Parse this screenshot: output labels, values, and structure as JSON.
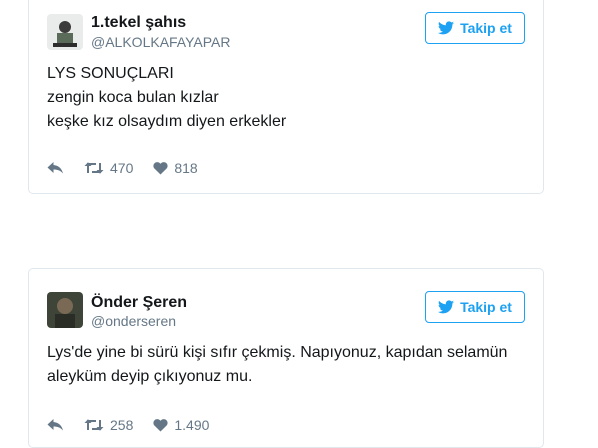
{
  "tweets": [
    {
      "name": "1.tekel şahıs",
      "handle": "@ALKOLKAFAYAPAR",
      "follow_label": "Takip et",
      "text_lines": [
        "LYS SONUÇLARI",
        "zengin koca bulan kızlar",
        "keşke kız olsaydım diyen erkekler"
      ],
      "retweets": "470",
      "likes": "818"
    },
    {
      "name": "Önder Şeren",
      "handle": "@onderseren",
      "follow_label": "Takip et",
      "text_lines": [
        "Lys'de yine bi sürü kişi sıfır çekmiş. Napıyonuz, kapıdan selamün",
        "aleyküm deyip çıkıyonuz mu."
      ],
      "retweets": "258",
      "likes": "1.490"
    }
  ],
  "colors": {
    "accent": "#1da1f2",
    "muted": "#657786",
    "border": "#e1e8ed"
  },
  "icons": {
    "follow": "twitter-bird-icon",
    "reply": "reply-icon",
    "retweet": "retweet-icon",
    "like": "heart-icon"
  }
}
